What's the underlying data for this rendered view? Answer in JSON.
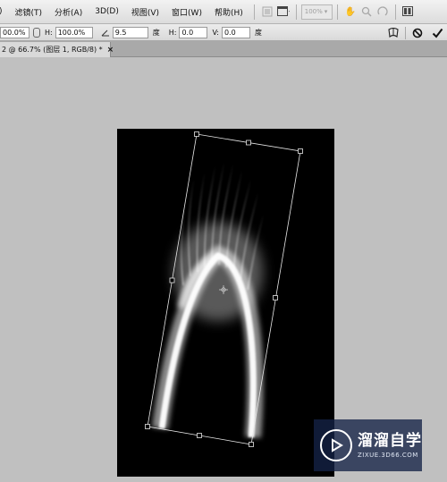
{
  "menubar": {
    "items": [
      ")",
      "滤镜(T)",
      "分析(A)",
      "3D(D)",
      "视图(V)",
      "窗口(W)",
      "帮助(H)"
    ],
    "zoom_level": "100%"
  },
  "options": {
    "width_value": "00.0%",
    "height_label": "H:",
    "height_value": "100.0%",
    "angle_value": "9.5",
    "angle_unit": "度",
    "hskew_label": "H:",
    "hskew_value": "0.0",
    "hskew_unit": "度",
    "vskew_label": "V:",
    "vskew_value": "0.0",
    "vskew_unit": "度"
  },
  "document_tab": {
    "title": "2 @ 66.7% (图层 1, RGB/8) *",
    "close_symbol": "×"
  },
  "watermark": {
    "title": "溜溜自学",
    "url": "ZIXUE.3D66.COM"
  },
  "colors": {
    "workspace": "#c0c0c0",
    "canvas": "#000000",
    "watermark_bg": "#14234a"
  }
}
